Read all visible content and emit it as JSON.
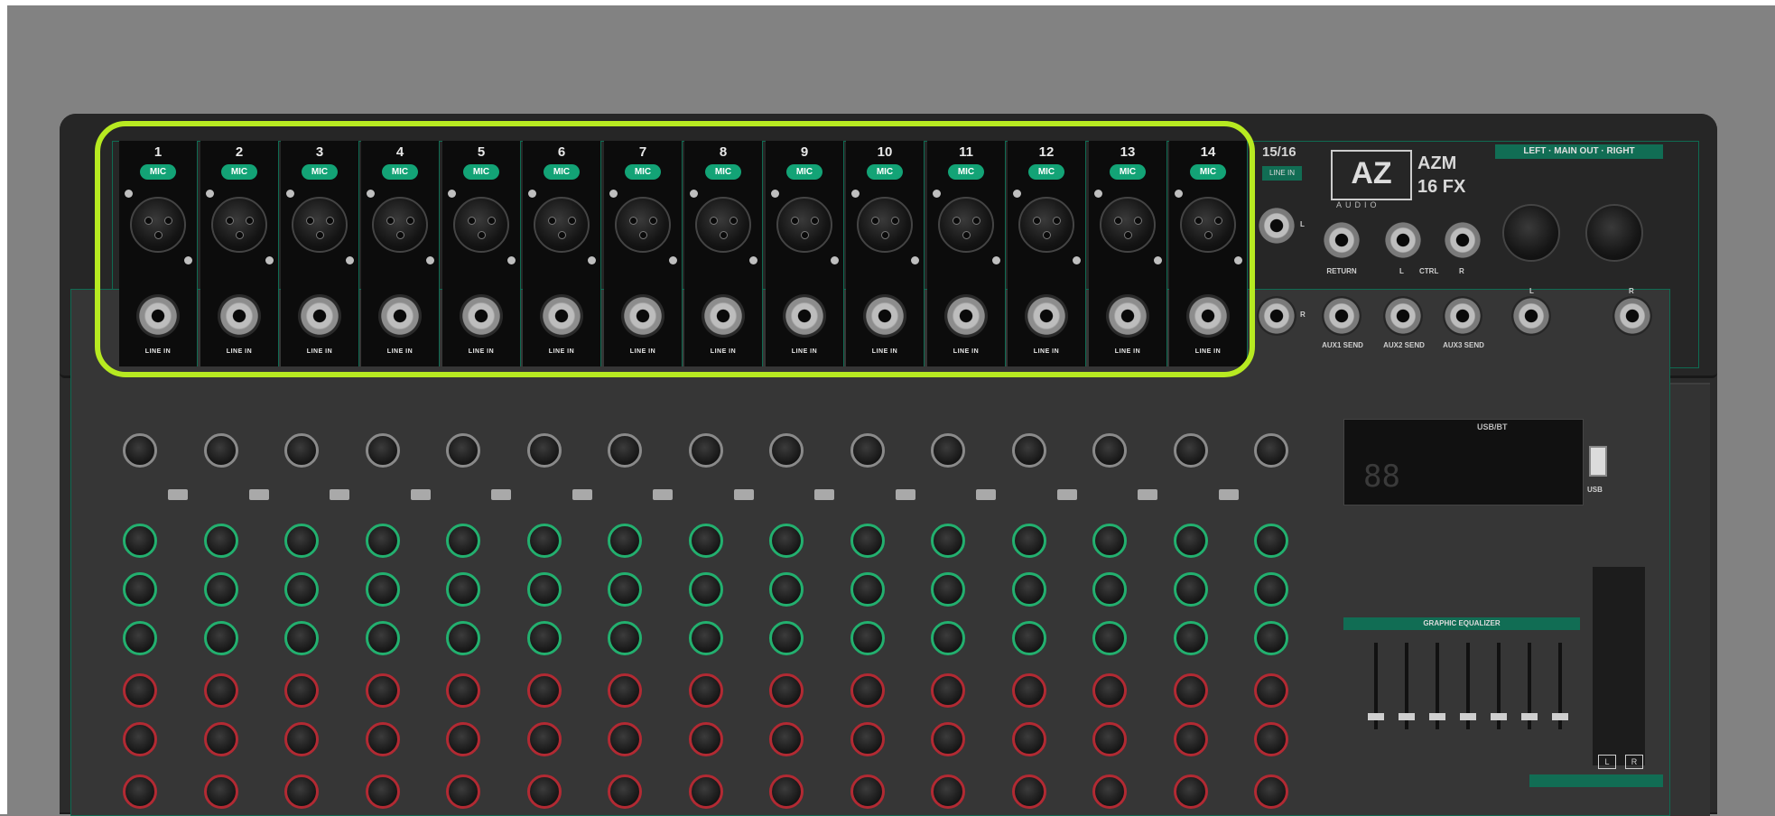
{
  "device": {
    "brand_logo": "AZ",
    "brand_sub": "AUDIO",
    "model_line1": "AZM",
    "model_line2": "16 FX"
  },
  "channels": [
    {
      "number": "1",
      "mic_label": "MIC",
      "line_label": "LINE IN"
    },
    {
      "number": "2",
      "mic_label": "MIC",
      "line_label": "LINE IN"
    },
    {
      "number": "3",
      "mic_label": "MIC",
      "line_label": "LINE IN"
    },
    {
      "number": "4",
      "mic_label": "MIC",
      "line_label": "LINE IN"
    },
    {
      "number": "5",
      "mic_label": "MIC",
      "line_label": "LINE IN"
    },
    {
      "number": "6",
      "mic_label": "MIC",
      "line_label": "LINE IN"
    },
    {
      "number": "7",
      "mic_label": "MIC",
      "line_label": "LINE IN"
    },
    {
      "number": "8",
      "mic_label": "MIC",
      "line_label": "LINE IN"
    },
    {
      "number": "9",
      "mic_label": "MIC",
      "line_label": "LINE IN"
    },
    {
      "number": "10",
      "mic_label": "MIC",
      "line_label": "LINE IN"
    },
    {
      "number": "11",
      "mic_label": "MIC",
      "line_label": "LINE IN"
    },
    {
      "number": "12",
      "mic_label": "MIC",
      "line_label": "LINE IN"
    },
    {
      "number": "13",
      "mic_label": "MIC",
      "line_label": "LINE IN"
    },
    {
      "number": "14",
      "mic_label": "MIC",
      "line_label": "LINE IN"
    }
  ],
  "stereo_channel": {
    "number": "15/16",
    "tag": "LINE IN",
    "left": "L",
    "right": "R"
  },
  "control_room": {
    "return": "RETURN",
    "left": "L",
    "ctrl": "CTRL",
    "right": "R"
  },
  "aux_sends": [
    "AUX1 SEND",
    "AUX2 SEND",
    "AUX3 SEND"
  ],
  "main_out": {
    "label": "LEFT · MAIN OUT · RIGHT",
    "left": "L",
    "right": "R"
  },
  "display": {
    "bt_label": "USB/BT"
  },
  "usb_label": "USB",
  "graphic_eq_label": "GRAPHIC EQUALIZER",
  "meter_labels": {
    "left": "L",
    "right": "R"
  },
  "colors": {
    "background": "#828282",
    "highlight": "#b7ea21",
    "accent_green": "#13a376",
    "panel": "#0c0c0c"
  }
}
